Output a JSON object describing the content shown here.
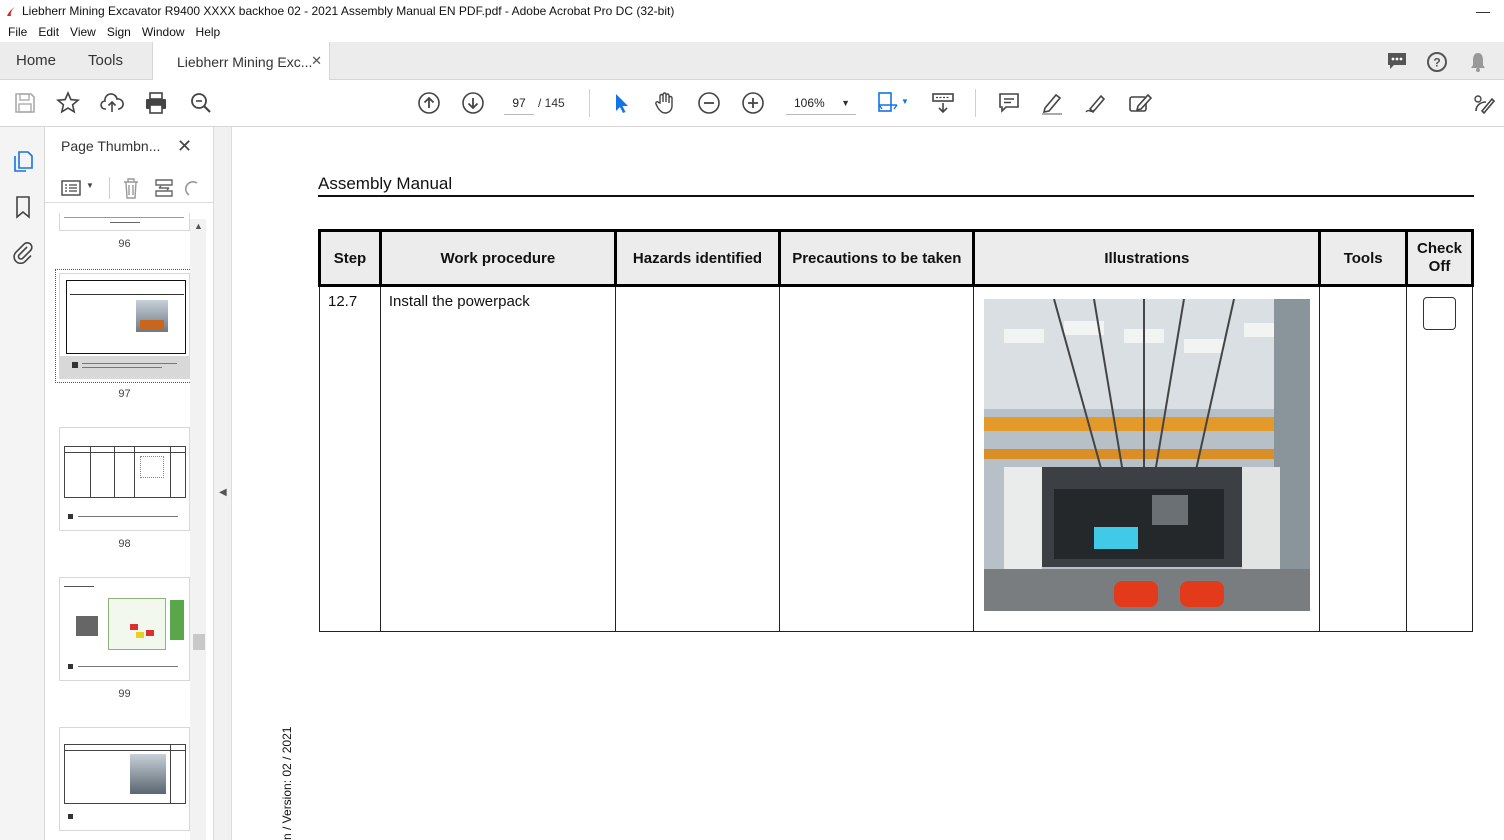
{
  "window": {
    "title": "Liebherr Mining Excavator R9400 XXXX backhoe 02 - 2021 Assembly Manual EN PDF.pdf - Adobe Acrobat Pro DC (32-bit)"
  },
  "menu": [
    "File",
    "Edit",
    "View",
    "Sign",
    "Window",
    "Help"
  ],
  "tabs": {
    "home": "Home",
    "tools": "Tools",
    "document": "Liebherr Mining Exc..."
  },
  "toolbar": {
    "current_page": "97",
    "page_total": "/ 145",
    "zoom": "106%"
  },
  "thumbnails": {
    "title": "Page Thumbn...",
    "pages": [
      "96",
      "97",
      "98",
      "99"
    ]
  },
  "document": {
    "header": "Assembly Manual",
    "columns": [
      "Step",
      "Work procedure",
      "Hazards identified",
      "Precautions to be taken",
      "Illustrations",
      "Tools",
      "Check Off"
    ],
    "rows": [
      {
        "step": "12.7",
        "work_procedure": "Install the powerpack",
        "hazards": "",
        "precautions": "",
        "tools": "",
        "checked": false
      }
    ],
    "version_text": "n / Version: 02 / 2021"
  },
  "colors": {
    "accent": "#1473e6",
    "select_tool": "#1473e6"
  }
}
